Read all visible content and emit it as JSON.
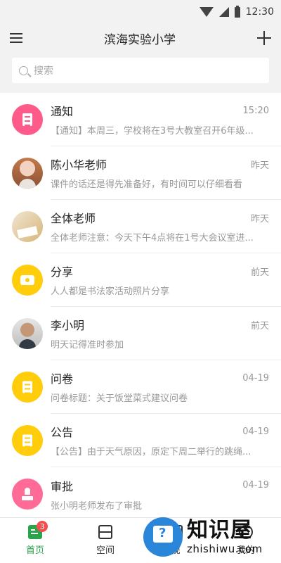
{
  "status_bar": {
    "time": "12:30"
  },
  "header": {
    "title": "滨海实验小学"
  },
  "search": {
    "placeholder": "搜索"
  },
  "conversations": [
    {
      "title": "通知",
      "time": "15:20",
      "preview": "【通知】本周三，学校将在3号大教室召开6年级...",
      "avatar": "notice-icon"
    },
    {
      "title": "陈小华老师",
      "time": "昨天",
      "preview": "课件的话还是得先准备好，有时间可以仔细看看",
      "avatar": "user-photo"
    },
    {
      "title": "全体老师",
      "time": "昨天",
      "preview": "全体老师注意：今天下午4点将在1号大会议室进...",
      "avatar": "group-photo"
    },
    {
      "title": "分享",
      "time": "前天",
      "preview": "人人都是书法家活动照片分享",
      "avatar": "camera-icon"
    },
    {
      "title": "李小明",
      "time": "前天",
      "preview": "明天记得准时参加",
      "avatar": "user-photo"
    },
    {
      "title": "问卷",
      "time": "04-19",
      "preview": "问卷标题：关于饭堂菜式建议问卷",
      "avatar": "survey-icon"
    },
    {
      "title": "公告",
      "time": "04-19",
      "preview": "【公告】由于天气原因，原定下周二举行的跳绳...",
      "avatar": "announcement-icon"
    },
    {
      "title": "审批",
      "time": "04-19",
      "preview": "张小明老师发布了审批",
      "avatar": "stamp-icon"
    }
  ],
  "tabbar": {
    "home": "首页",
    "home_badge": "3",
    "space": "空间",
    "tab3": "视",
    "me": "我的"
  },
  "watermark": {
    "brand": "知识屋",
    "url": "zhishiwu.com"
  },
  "colors": {
    "accent": "#2aa44a",
    "badge": "#f24e4e",
    "notice": "#ff5b8a",
    "yellow": "#ffcd0b"
  }
}
